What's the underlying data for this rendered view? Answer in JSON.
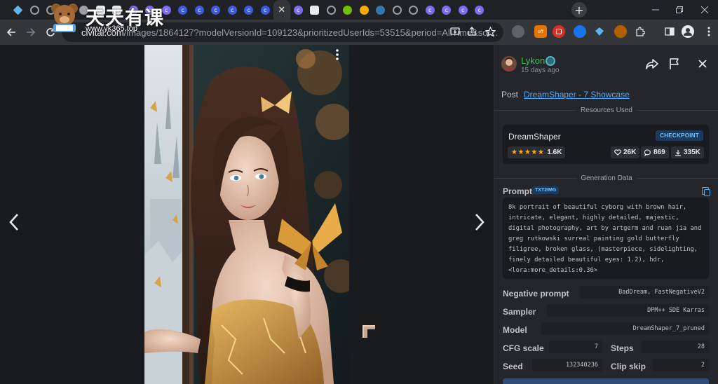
{
  "browser": {
    "tabs": [
      {
        "icon": "diamond-icon",
        "color": "#5fb3f0"
      },
      {
        "icon": "globe-icon",
        "color": "#9aa0a6"
      },
      {
        "icon": "globe-icon",
        "color": "#9aa0a6"
      },
      {
        "icon": "globe-icon",
        "color": "#9aa0a6"
      },
      {
        "icon": "extension-icon",
        "color": "#9aa0a6"
      },
      {
        "icon": "document-icon",
        "color": "#e8eaed"
      },
      {
        "icon": "github-icon",
        "color": "#e8eaed"
      },
      {
        "icon": "civitai-icon",
        "color": "#7b6cf0"
      },
      {
        "icon": "civitai-icon",
        "color": "#7b6cf0"
      },
      {
        "icon": "civitai-icon",
        "color": "#7b6cf0"
      },
      {
        "icon": "c-circle-icon",
        "color": "#3b5bdb"
      },
      {
        "icon": "c-circle-icon",
        "color": "#3b5bdb"
      },
      {
        "icon": "c-circle-icon",
        "color": "#3b5bdb"
      },
      {
        "icon": "c-circle-icon",
        "color": "#3b5bdb"
      },
      {
        "icon": "c-circle-icon",
        "color": "#3b5bdb"
      },
      {
        "icon": "c-circle-icon",
        "color": "#3b5bdb"
      },
      {
        "icon": "close-icon",
        "color": "#e8eaed",
        "active": true
      },
      {
        "icon": "civitai-icon",
        "color": "#7b6cf0"
      },
      {
        "icon": "gear-icon",
        "color": "#e8eaed"
      },
      {
        "icon": "globe-icon",
        "color": "#9aa0a6"
      },
      {
        "icon": "nvidia-icon",
        "color": "#76b900"
      },
      {
        "icon": "colab-icon",
        "color": "#f9ab00"
      },
      {
        "icon": "python-icon",
        "color": "#3776ab"
      },
      {
        "icon": "globe-icon",
        "color": "#9aa0a6"
      },
      {
        "icon": "globe-icon",
        "color": "#9aa0a6"
      },
      {
        "icon": "civitai-icon",
        "color": "#7b6cf0"
      },
      {
        "icon": "civitai-icon",
        "color": "#7b6cf0"
      },
      {
        "icon": "civitai-icon",
        "color": "#7b6cf0"
      },
      {
        "icon": "civitai-icon",
        "color": "#7b6cf0"
      }
    ],
    "url_host": "civitai.com",
    "url_path": "/images/1864127?modelVersionId=109123&prioritizedUserIds=53515&period=AllTime&sor...",
    "new_tab_label": "+",
    "watermark_title": "天天有课",
    "watermark_url": "www.yk365.top"
  },
  "viewer": {
    "prev_label": "‹",
    "next_label": "›",
    "menu_label": "⋮"
  },
  "panel": {
    "username": "Lykon",
    "posted_time": "15 days ago",
    "post_label": "Post",
    "post_link": "DreamShaper - 7 Showcase",
    "resources_heading": "Resources Used",
    "resource": {
      "name": "DreamShaper",
      "type": "CHECKPOINT",
      "rating": 5,
      "rating_count": "1.6K",
      "likes": "26K",
      "comments": "869",
      "downloads": "335K"
    },
    "generation_heading": "Generation Data",
    "prompt_label": "Prompt",
    "prompt_mode": "TXT2IMG",
    "prompt_text": "8k portrait of beautiful cyborg with brown hair, intricate, elegant, highly detailed, majestic, digital photography, art by artgerm and ruan jia and greg rutkowski surreal painting gold butterfly filigree, broken glass, (masterpiece, sidelighting, finely detailed beautiful eyes: 1.2), hdr, <lora:more_details:0.36>",
    "negative_label": "Negative prompt",
    "negative_value": "BadDream, FastNegativeV2",
    "sampler_label": "Sampler",
    "sampler_value": "DPM++ SDE Karras",
    "model_label": "Model",
    "model_value": "DreamShaper_7_pruned",
    "cfg_label": "CFG scale",
    "cfg_value": "7",
    "steps_label": "Steps",
    "steps_value": "28",
    "seed_label": "Seed",
    "seed_value": "132340236",
    "clip_label": "Clip skip",
    "clip_value": "2"
  },
  "colors": {
    "accent_link": "#4dabf7",
    "username": "#40c057",
    "star": "#fab005",
    "badge_bg": "#1c3a5e",
    "badge_text": "#74c0fc"
  }
}
